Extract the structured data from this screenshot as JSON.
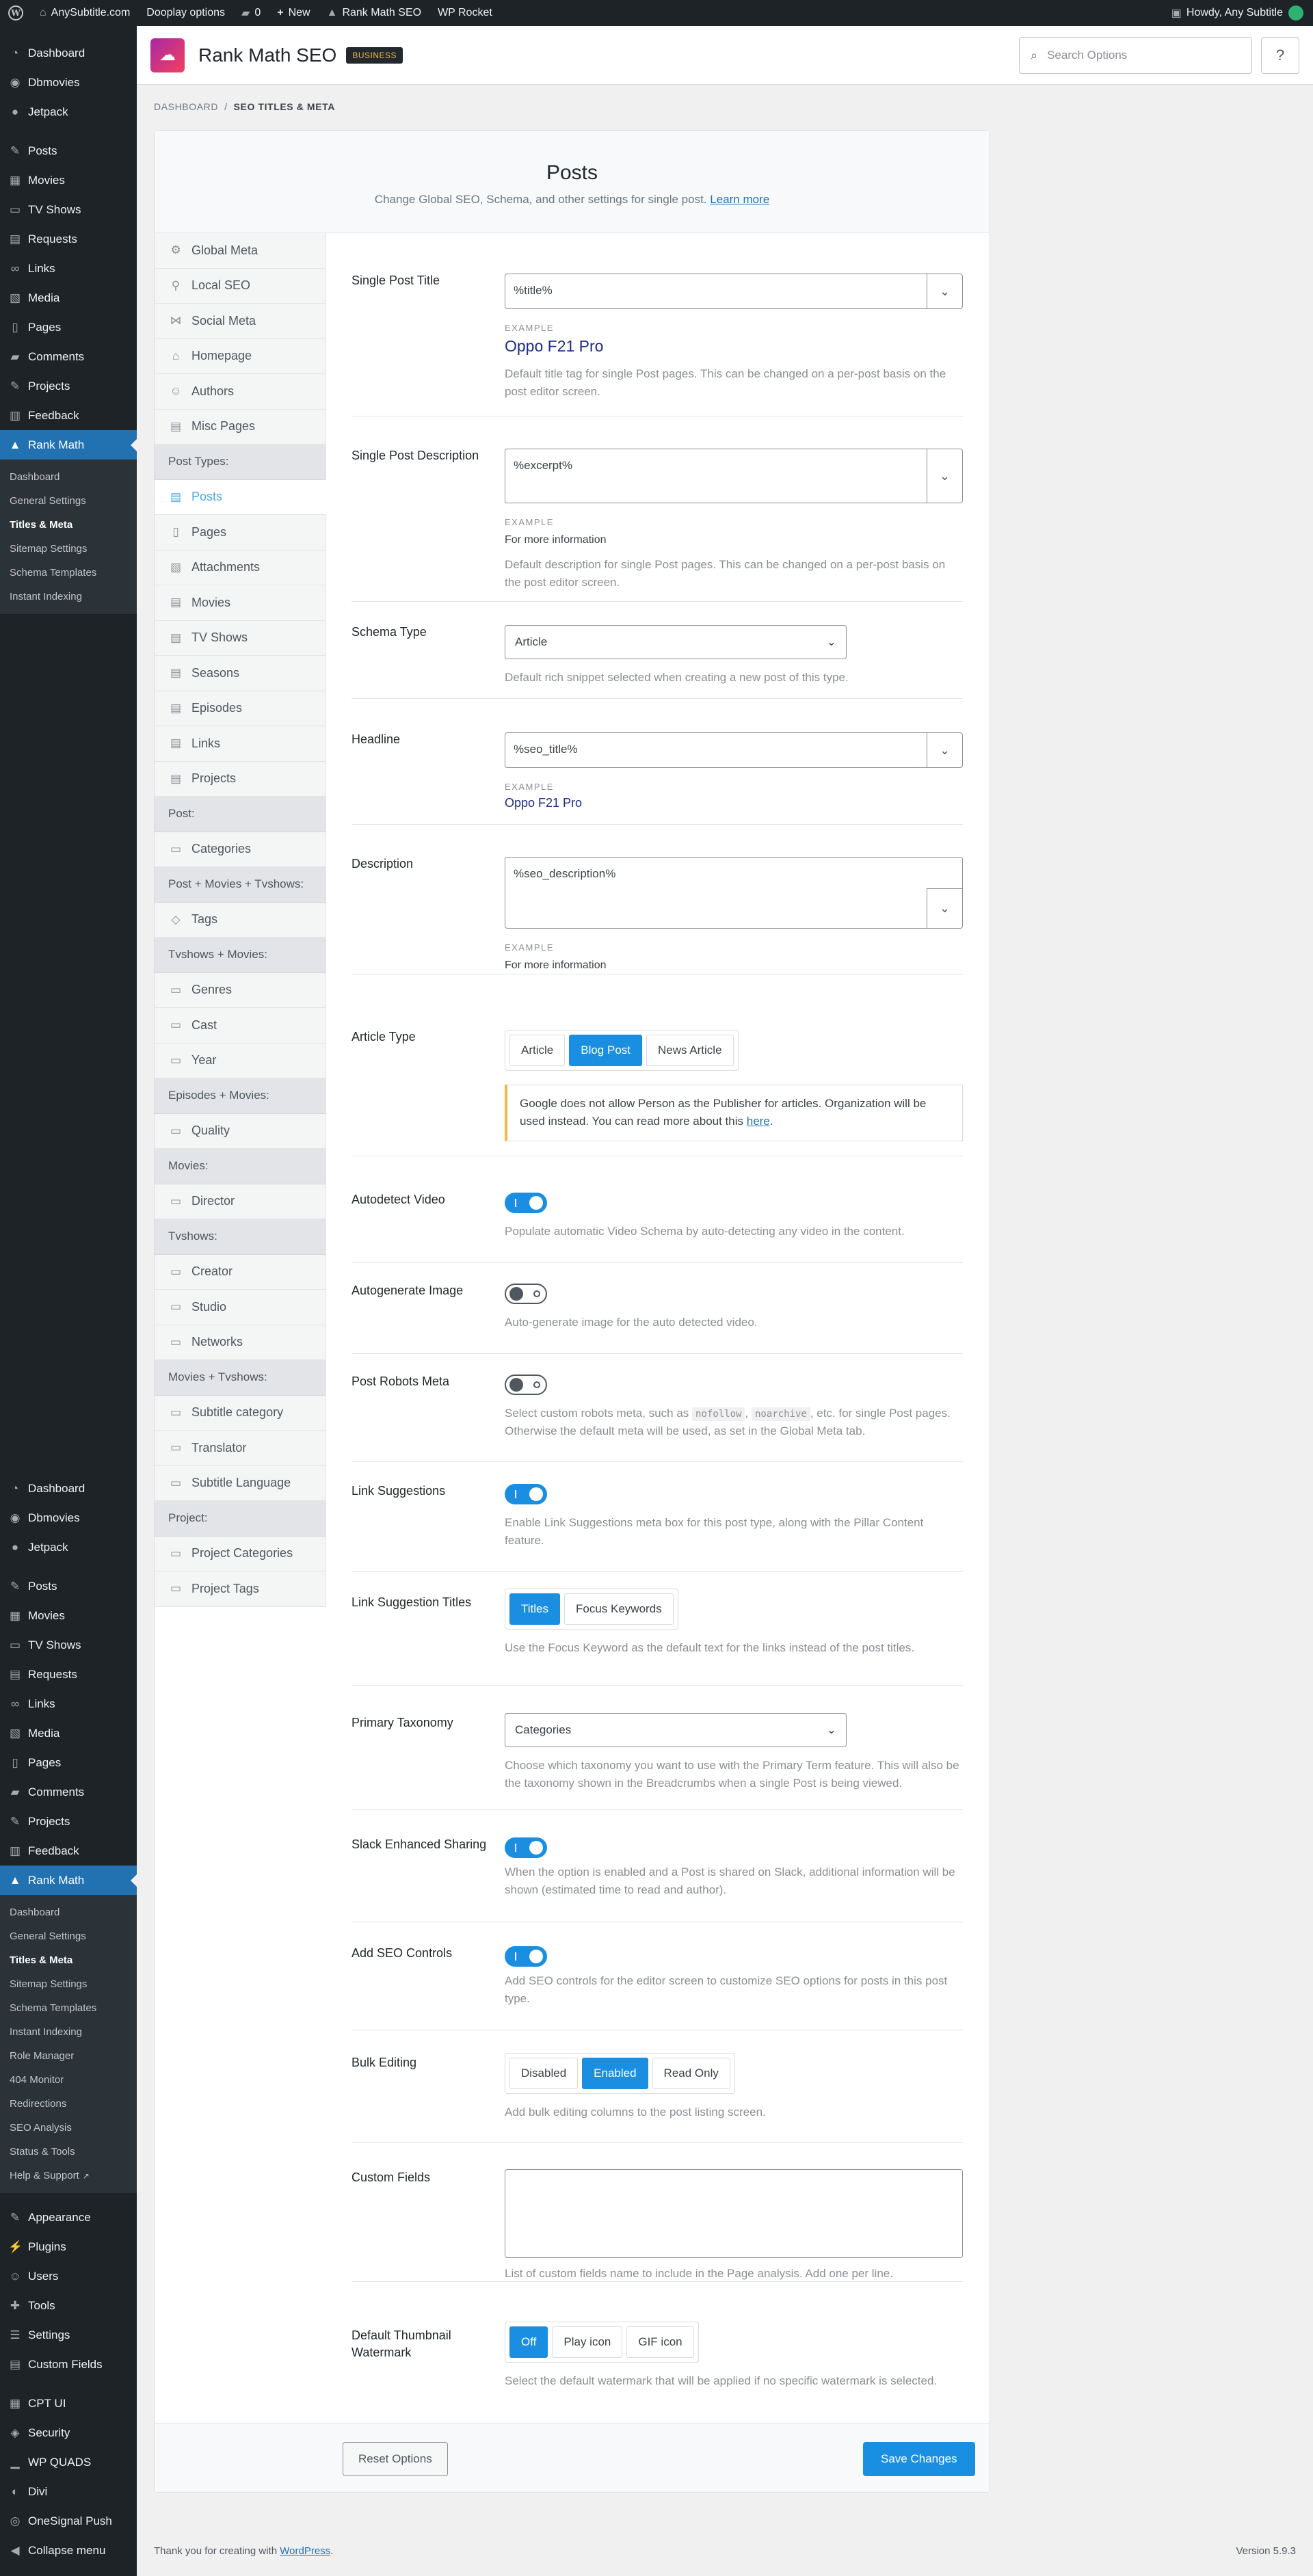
{
  "adminbar": {
    "site": "AnySubtitle.com",
    "dooplay": "Dooplay options",
    "comments": "0",
    "new": "New",
    "rankmath": "Rank Math SEO",
    "wprocket": "WP Rocket",
    "howdy": "Howdy, Any Subtitle"
  },
  "sidebar": {
    "top": [
      "Dashboard",
      "Dbmovies",
      "Jetpack"
    ],
    "content": [
      "Posts",
      "Movies",
      "TV Shows",
      "Requests",
      "Links",
      "Media",
      "Pages",
      "Comments",
      "Projects",
      "Feedback"
    ],
    "rankmath": "Rank Math",
    "sub1": [
      "Dashboard",
      "General Settings",
      "Titles & Meta",
      "Sitemap Settings",
      "Schema Templates",
      "Instant Indexing"
    ],
    "sub2": [
      "Dashboard",
      "General Settings",
      "Titles & Meta",
      "Sitemap Settings",
      "Schema Templates",
      "Instant Indexing",
      "Role Manager",
      "404 Monitor",
      "Redirections",
      "SEO Analysis",
      "Status & Tools",
      "Help & Support"
    ],
    "bottom": [
      "Appearance",
      "Plugins",
      "Users",
      "Tools",
      "Settings",
      "Custom Fields"
    ],
    "extra": [
      "CPT UI",
      "Security",
      "WP QUADS",
      "Divi",
      "OneSignal Push",
      "Collapse menu"
    ]
  },
  "header": {
    "title": "Rank Math SEO",
    "badge": "BUSINESS",
    "search_placeholder": "Search Options"
  },
  "breadcrumb": {
    "root": "DASHBOARD",
    "sep": "/",
    "current": "SEO TITLES & META"
  },
  "page": {
    "title": "Posts",
    "subtitle": "Change Global SEO, Schema, and other settings for single post.",
    "learn_more": "Learn more"
  },
  "nav": {
    "general": [
      "Global Meta",
      "Local SEO",
      "Social Meta",
      "Homepage",
      "Authors",
      "Misc Pages"
    ],
    "post_types_heading": "Post Types:",
    "post_types": [
      "Posts",
      "Pages",
      "Attachments",
      "Movies",
      "TV Shows",
      "Seasons",
      "Episodes",
      "Links",
      "Projects"
    ],
    "groups": [
      {
        "heading": "Post:",
        "items": [
          "Categories"
        ]
      },
      {
        "heading": "Post + Movies + Tvshows:",
        "items": [
          "Tags"
        ]
      },
      {
        "heading": "Tvshows + Movies:",
        "items": [
          "Genres",
          "Cast",
          "Year"
        ]
      },
      {
        "heading": "Episodes + Movies:",
        "items": [
          "Quality"
        ]
      },
      {
        "heading": "Movies:",
        "items": [
          "Director"
        ]
      },
      {
        "heading": "Tvshows:",
        "items": [
          "Creator",
          "Studio",
          "Networks"
        ]
      },
      {
        "heading": "Movies + Tvshows:",
        "items": [
          "Subtitle category",
          "Translator",
          "Subtitle Language"
        ]
      },
      {
        "heading": "Project:",
        "items": [
          "Project Categories",
          "Project Tags"
        ]
      }
    ]
  },
  "fields": {
    "title": {
      "label": "Single Post Title",
      "value": "%title%",
      "example_label": "EXAMPLE",
      "example": "Oppo F21 Pro",
      "desc": "Default title tag for single Post pages. This can be changed on a per-post basis on the post editor screen."
    },
    "description": {
      "label": "Single Post Description",
      "value": "%excerpt%",
      "example_label": "EXAMPLE",
      "example": "For more information",
      "desc": "Default description for single Post pages. This can be changed on a per-post basis on the post editor screen."
    },
    "schema": {
      "label": "Schema Type",
      "value": "Article",
      "desc": "Default rich snippet selected when creating a new post of this type."
    },
    "headline": {
      "label": "Headline",
      "value": "%seo_title%",
      "example_label": "EXAMPLE",
      "example": "Oppo F21 Pro"
    },
    "sdesc": {
      "label": "Description",
      "value": "%seo_description%",
      "example_label": "EXAMPLE",
      "example": "For more information"
    },
    "article_type": {
      "label": "Article Type",
      "options": [
        "Article",
        "Blog Post",
        "News Article"
      ],
      "selected": "Blog Post",
      "notice": "Google does not allow Person as the Publisher for articles. Organization will be used instead. You can read more about this",
      "notice_link": "here",
      "notice_end": "."
    },
    "autodetect": {
      "label": "Autodetect Video",
      "desc": "Populate automatic Video Schema by auto-detecting any video in the content."
    },
    "autogenerate": {
      "label": "Autogenerate Image",
      "desc": "Auto-generate image for the auto detected video."
    },
    "robots": {
      "label": "Post Robots Meta",
      "desc_a": "Select custom robots meta, such as",
      "code1": "nofollow",
      "comma": ",",
      "code2": "noarchive",
      "desc_b": ", etc. for single Post pages. Otherwise the default meta will be used, as set in the Global Meta tab."
    },
    "link_suggestions": {
      "label": "Link Suggestions",
      "desc": "Enable Link Suggestions meta box for this post type, along with the Pillar Content feature."
    },
    "link_titles": {
      "label": "Link Suggestion Titles",
      "options": [
        "Titles",
        "Focus Keywords"
      ],
      "desc": "Use the Focus Keyword as the default text for the links instead of the post titles."
    },
    "taxonomy": {
      "label": "Primary Taxonomy",
      "value": "Categories",
      "desc": "Choose which taxonomy you want to use with the Primary Term feature. This will also be the taxonomy shown in the Breadcrumbs when a single Post is being viewed."
    },
    "slack": {
      "label": "Slack Enhanced Sharing",
      "desc": "When the option is enabled and a Post is shared on Slack, additional information will be shown (estimated time to read and author)."
    },
    "seo_controls": {
      "label": "Add SEO Controls",
      "desc": "Add SEO controls for the editor screen to customize SEO options for posts in this post type."
    },
    "bulk": {
      "label": "Bulk Editing",
      "options": [
        "Disabled",
        "Enabled",
        "Read Only"
      ],
      "desc": "Add bulk editing columns to the post listing screen."
    },
    "custom_fields": {
      "label": "Custom Fields",
      "desc": "List of custom fields name to include in the Page analysis. Add one per line."
    },
    "watermark": {
      "label": "Default Thumbnail Watermark",
      "options": [
        "Off",
        "Play icon",
        "GIF icon"
      ],
      "desc": "Select the default watermark that will be applied if no specific watermark is selected."
    }
  },
  "footer": {
    "reset": "Reset Options",
    "save": "Save Changes",
    "thanks": "Thank you for creating with",
    "wp": "WordPress",
    "dot": ".",
    "version": "Version 5.9.3"
  },
  "colors": {
    "accent": "#1a8fe1",
    "adminbar": "#1d2327",
    "menu_current": "#2271b1"
  }
}
